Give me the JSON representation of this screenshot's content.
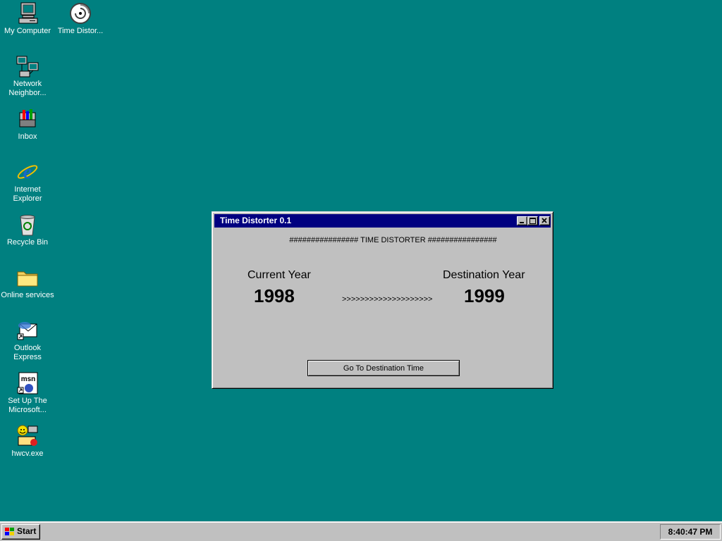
{
  "desktop": {
    "icons": [
      {
        "icon": "my-computer-icon",
        "label": "My Computer"
      },
      {
        "icon": "time-distorter-icon",
        "label": "Time Distor..."
      },
      {
        "icon": "network-neighborhood-icon",
        "label": "Network Neighbor..."
      },
      {
        "icon": "inbox-icon",
        "label": "Inbox"
      },
      {
        "icon": "internet-explorer-icon",
        "label": "Internet Explorer"
      },
      {
        "icon": "recycle-bin-icon",
        "label": "Recycle Bin"
      },
      {
        "icon": "folder-icon",
        "label": "Online services"
      },
      {
        "icon": "outlook-express-icon",
        "label": "Outlook Express"
      },
      {
        "icon": "msn-setup-icon",
        "label": "Set Up The Microsoft..."
      },
      {
        "icon": "hwcv-icon",
        "label": "hwcv.exe"
      }
    ]
  },
  "window": {
    "title": "Time Distorter 0.1",
    "banner": "################ TIME DISTORTER ################",
    "current_year_label": "Current Year",
    "current_year": "1998",
    "destination_year_label": "Destination Year",
    "destination_year": "1999",
    "arrows": ">>>>>>>>>>>>>>>>>>>>",
    "go_button_label": "Go To Destination Time"
  },
  "taskbar": {
    "start_label": "Start",
    "clock": "8:40:47 PM"
  },
  "colors": {
    "desktop": "#008080",
    "titlebar": "#000080",
    "face": "#c0c0c0"
  }
}
